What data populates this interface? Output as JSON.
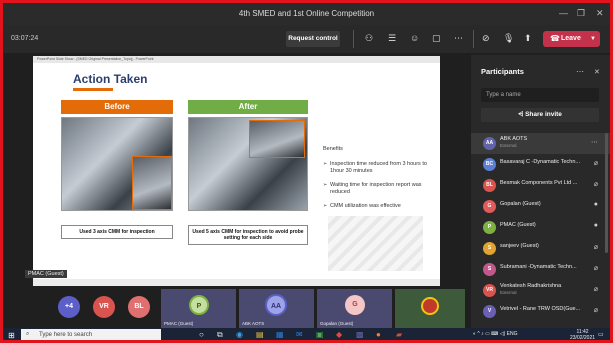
{
  "window": {
    "title": "4th SMED and 1st Online Competition",
    "minimize": "—",
    "maximize": "❐",
    "close": "✕"
  },
  "toolbar": {
    "timer": "03:07:24",
    "request_control": "Request control",
    "leave": "Leave"
  },
  "slide": {
    "app_bar": "PowerPoint Slide Show - [SMED Original Presentation_Topiq] - PowerPoint",
    "title": "Action Taken",
    "before_header": "Before",
    "after_header": "After",
    "before_caption": "Used 3 axis CMM for inspection",
    "after_caption": "Used 5 axis CMM for inspection to avoid probe setting for each side",
    "benefits_title": "Benefits",
    "benefits": [
      "Inspection time reduced from 3 hours to 1hour 30 minutes",
      "Waiting time for inspection report was reduced",
      "CMM utilization was effective"
    ]
  },
  "presenter_tag": "PMAC (Guest)",
  "strip": {
    "overflow": "+4",
    "vr": "VR",
    "bl": "BL",
    "tiles": [
      {
        "initial": "P",
        "name": "PMAC (Guest)"
      },
      {
        "initial": "AA",
        "name": "ABK AOTS"
      },
      {
        "initial": "G",
        "name": "Gopalan (Guest)"
      }
    ]
  },
  "panel": {
    "title": "Participants",
    "search_placeholder": "Type a name",
    "share_invite": "Share invite",
    "participants": [
      {
        "initials": "AA",
        "name": "ABK AOTS",
        "sub": "External",
        "color": "#6264a7"
      },
      {
        "initials": "BC",
        "name": "Basavaraj C -Dynamatic Techn...",
        "sub": "",
        "color": "#5b7fd6"
      },
      {
        "initials": "BL",
        "name": "Besmak Components Pvt Ltd ...",
        "sub": "",
        "color": "#d9534f"
      },
      {
        "initials": "G",
        "name": "Gopalan (Guest)",
        "sub": "",
        "color": "#e05b5b"
      },
      {
        "initials": "P",
        "name": "PMAC (Guest)",
        "sub": "",
        "color": "#7fb042"
      },
      {
        "initials": "S",
        "name": "sanjeev (Guest)",
        "sub": "",
        "color": "#e2a32f"
      },
      {
        "initials": "S",
        "name": "Subramani -Dynamatic Techn...",
        "sub": "",
        "color": "#c2588a"
      },
      {
        "initials": "VR",
        "name": "Venkatesh Radhakrishna",
        "sub": "External",
        "color": "#d9534f"
      },
      {
        "initials": "V",
        "name": "Vetrivel - Rane TRW OSD(Gue...",
        "sub": "",
        "color": "#6b5fb5"
      }
    ]
  },
  "taskbar": {
    "search_placeholder": "Type here to search",
    "tray_lang": "ENG",
    "time": "11:42",
    "date": "23/02/2021"
  }
}
